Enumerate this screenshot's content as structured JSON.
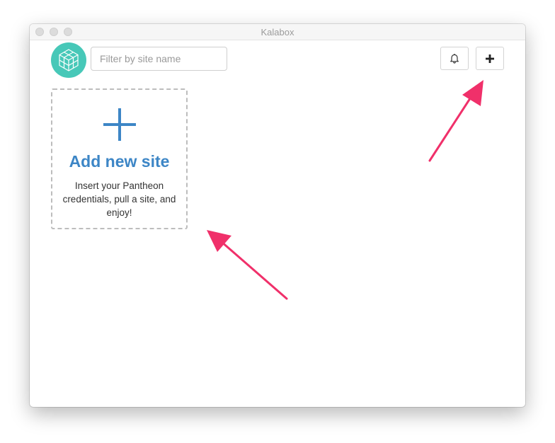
{
  "window": {
    "title": "Kalabox"
  },
  "header": {
    "logo_icon": "kalabox-cube-logo-icon",
    "search_placeholder": "Filter by site name",
    "search_value": "",
    "notifications_icon": "bell-icon",
    "add_icon": "plus-icon"
  },
  "add_site_card": {
    "icon": "plus-icon",
    "title": "Add new site",
    "description": "Insert your Pantheon credentials, pull a site, and enjoy!"
  },
  "annotations": {
    "arrow_color": "#f0306a"
  },
  "colors": {
    "accent": "#3d86c6",
    "logo": "#47c8b8"
  }
}
